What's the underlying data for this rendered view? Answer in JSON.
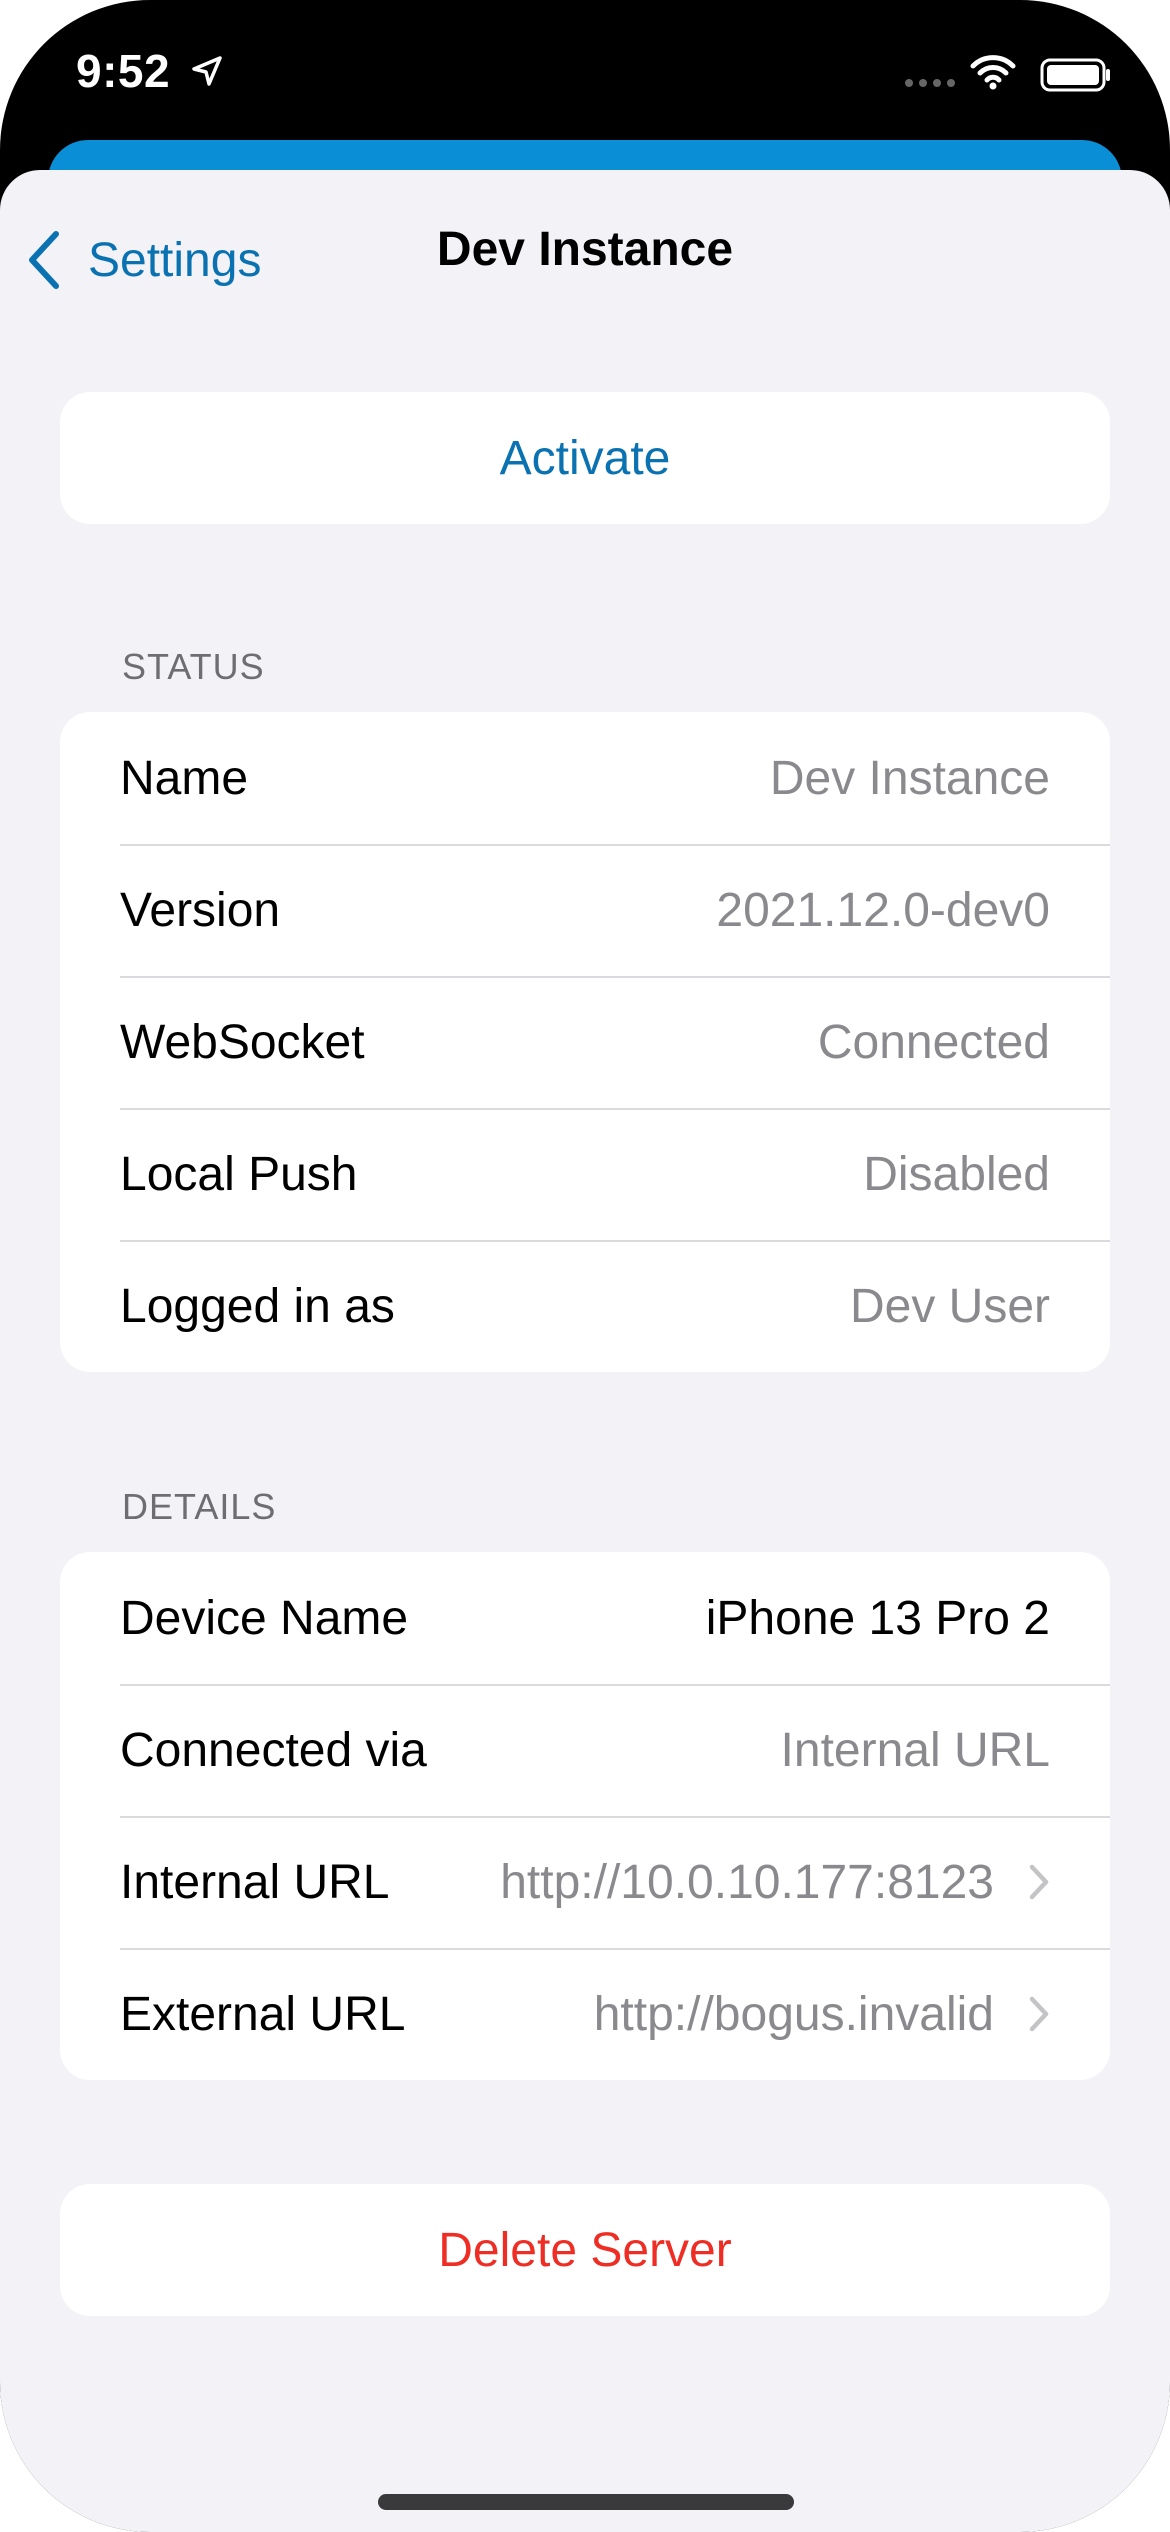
{
  "status_bar": {
    "time": "9:52"
  },
  "nav": {
    "back_label": "Settings",
    "title": "Dev Instance"
  },
  "activate": {
    "label": "Activate"
  },
  "status_section": {
    "header": "STATUS",
    "rows": [
      {
        "label": "Name",
        "value": "Dev Instance"
      },
      {
        "label": "Version",
        "value": "2021.12.0-dev0"
      },
      {
        "label": "WebSocket",
        "value": "Connected"
      },
      {
        "label": "Local Push",
        "value": "Disabled"
      },
      {
        "label": "Logged in as",
        "value": "Dev User"
      }
    ]
  },
  "details_section": {
    "header": "DETAILS",
    "rows": [
      {
        "label": "Device Name",
        "value": "iPhone 13 Pro 2"
      },
      {
        "label": "Connected via",
        "value": "Internal URL"
      },
      {
        "label": "Internal URL",
        "value": "http://10.0.10.177:8123"
      },
      {
        "label": "External URL",
        "value": "http://bogus.invalid"
      }
    ]
  },
  "delete": {
    "label": "Delete Server"
  },
  "colors": {
    "accent": "#0b72b2",
    "destructive": "#ee2e24",
    "background": "#f2f2f7",
    "secondary_text": "#8a8a8e",
    "sheet_behind": "#0a8fd7"
  },
  "icons": {
    "location": "location-arrow-icon",
    "wifi": "wifi-icon",
    "battery": "battery-icon",
    "cellular": "cellular-dots-icon",
    "back": "chevron-left-icon",
    "disclosure": "chevron-right-icon"
  }
}
